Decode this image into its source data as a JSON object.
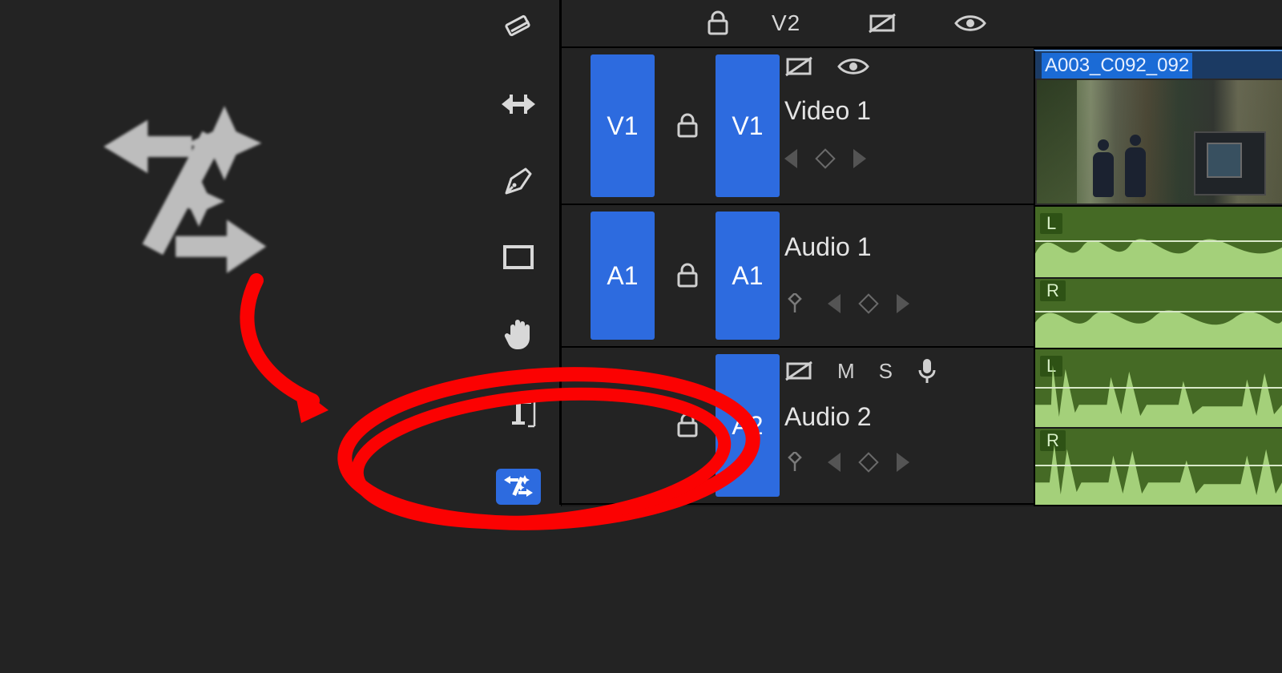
{
  "toolbar": {
    "tools": [
      {
        "name": "razor-tool-icon"
      },
      {
        "name": "slip-tool-icon"
      },
      {
        "name": "pen-tool-icon"
      },
      {
        "name": "rectangle-tool-icon"
      },
      {
        "name": "hand-tool-icon"
      },
      {
        "name": "type-tool-icon"
      },
      {
        "name": "remix-tool-icon"
      }
    ],
    "selected_index": 6
  },
  "tracks": {
    "v2": {
      "label": "V2"
    },
    "v1": {
      "target": "V1",
      "patch": "V1",
      "name": "Video 1"
    },
    "a1": {
      "target": "A1",
      "patch": "A1",
      "name": "Audio 1"
    },
    "a2": {
      "patch": "A2",
      "name": "Audio 2",
      "mute": "M",
      "solo": "S"
    }
  },
  "clips": {
    "video1": {
      "label": "A003_C092_092"
    },
    "audio1": {
      "left": "L",
      "right": "R"
    },
    "audio2": {
      "left": "L",
      "right": "R"
    }
  },
  "colors": {
    "accent": "#2d6bdf",
    "annotation": "#fb0202",
    "waveform": "#a4d07a",
    "waveform_bg": "#456a25"
  }
}
